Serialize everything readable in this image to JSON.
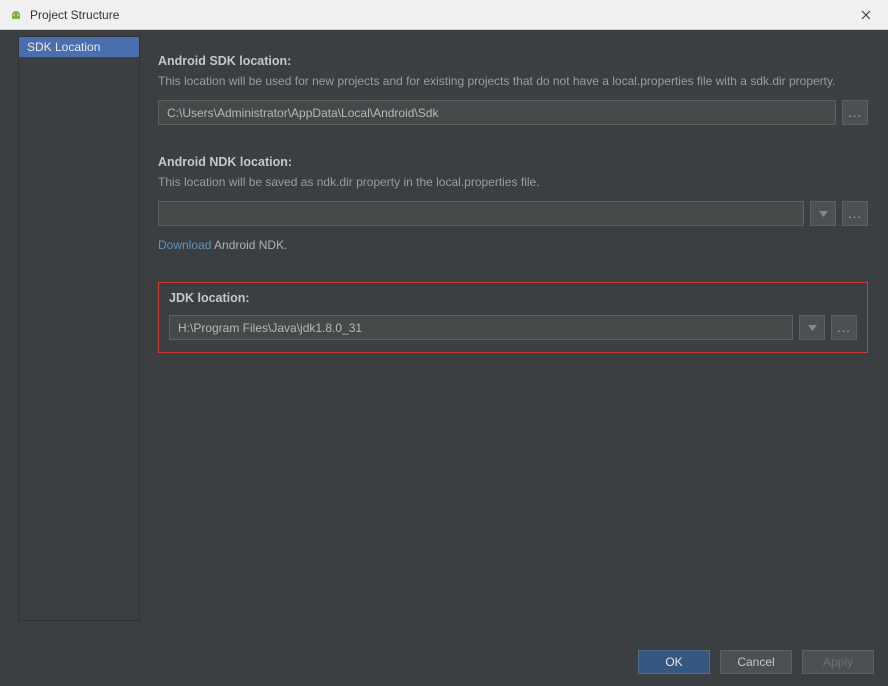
{
  "titlebar": {
    "title": "Project Structure"
  },
  "sidebar": {
    "item_sdk": "SDK Location"
  },
  "sdk": {
    "title": "Android SDK location:",
    "desc": "This location will be used for new projects and for existing projects that do not have a local.properties file with a sdk.dir property.",
    "value": "C:\\Users\\Administrator\\AppData\\Local\\Android\\Sdk"
  },
  "ndk": {
    "title": "Android NDK location:",
    "desc": "This location will be saved as ndk.dir property in the local.properties file.",
    "value": "",
    "download_link": "Download",
    "download_tail": " Android NDK."
  },
  "jdk": {
    "title": "JDK location:",
    "value": "H:\\Program Files\\Java\\jdk1.8.0_31"
  },
  "buttons": {
    "ok": "OK",
    "cancel": "Cancel",
    "apply": "Apply"
  }
}
